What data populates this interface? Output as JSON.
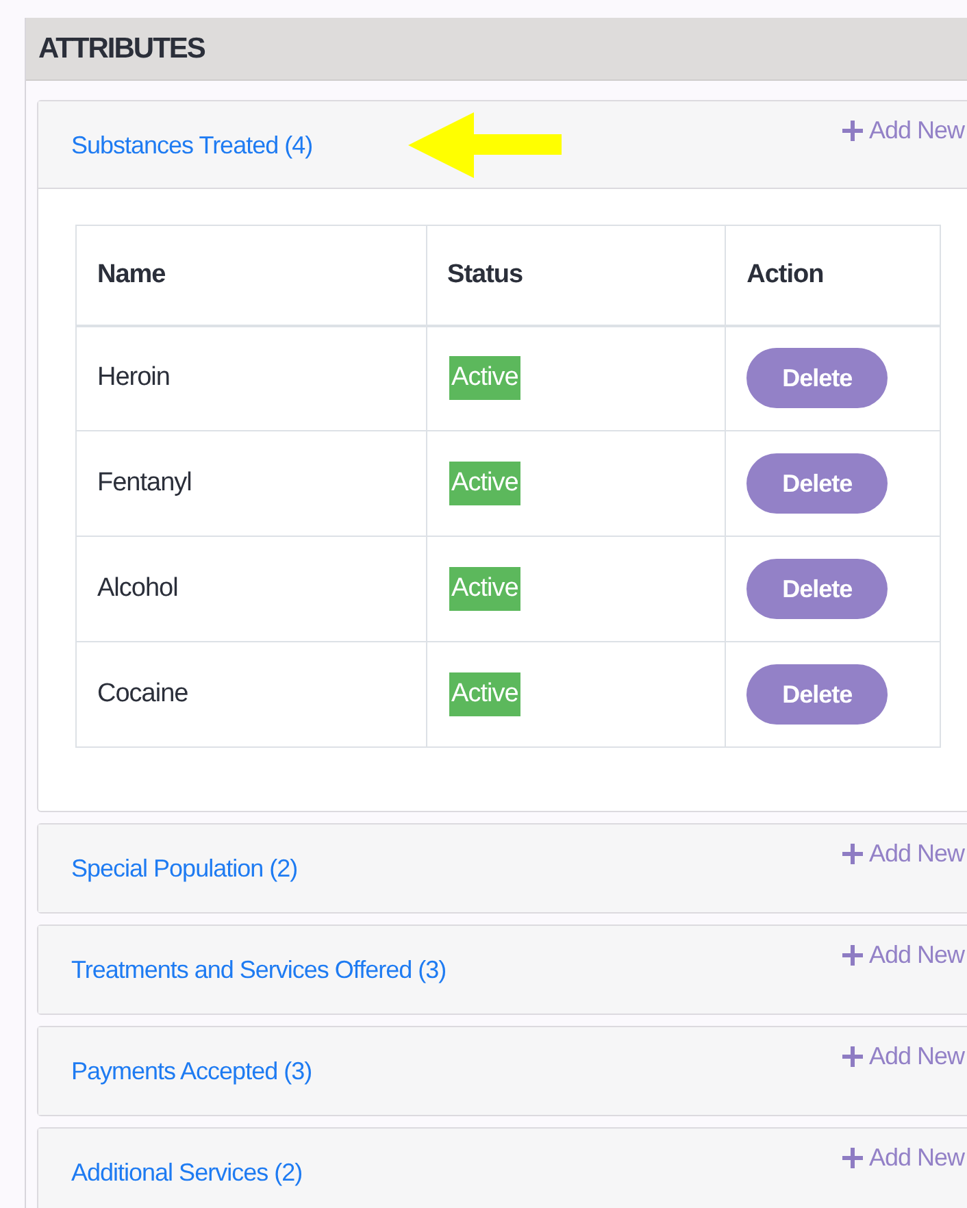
{
  "panel": {
    "title": "ATTRIBUTES"
  },
  "sections": [
    {
      "title": "Substances Treated (4)",
      "action": "Add New",
      "expanded": true,
      "highlighted": true,
      "table": {
        "columns": [
          "Name",
          "Status",
          "Action"
        ],
        "rows": [
          {
            "name": "Heroin",
            "status": "Active",
            "action": "Delete"
          },
          {
            "name": "Fentanyl",
            "status": "Active",
            "action": "Delete"
          },
          {
            "name": "Alcohol",
            "status": "Active",
            "action": "Delete"
          },
          {
            "name": "Cocaine",
            "status": "Active",
            "action": "Delete"
          }
        ]
      }
    },
    {
      "title": "Special Population (2)",
      "action": "Add New",
      "expanded": false,
      "highlighted": false
    },
    {
      "title": "Treatments and Services Offered (3)",
      "action": "Add New",
      "expanded": false,
      "highlighted": false
    },
    {
      "title": "Payments Accepted (3)",
      "action": "Add New",
      "expanded": false,
      "highlighted": false
    },
    {
      "title": "Additional Services (2)",
      "action": "Add New",
      "expanded": false,
      "highlighted": false
    }
  ]
}
